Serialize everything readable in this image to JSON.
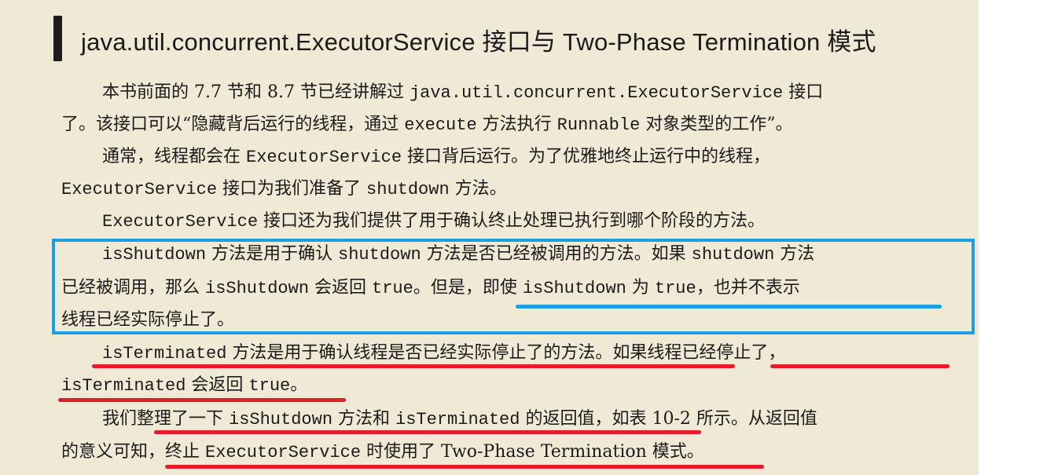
{
  "title": "java.util.concurrent.ExecutorService 接口与 Two-Phase Termination 模式",
  "paragraphs": {
    "p1": {
      "l1a": "本书前面的 7.7 节和 8.7 节已经讲解过 ",
      "l1b": "java.util.concurrent.ExecutorService",
      "l1c": " 接口",
      "l2a": "了。该接口可以“隐藏背后运行的线程，通过 ",
      "l2b": "execute",
      "l2c": " 方法执行 ",
      "l2d": "Runnable",
      "l2e": " 对象类型的工作”。"
    },
    "p2": {
      "l1a": "通常，线程都会在 ",
      "l1b": "ExecutorService",
      "l1c": " 接口背后运行。为了优雅地终止运行中的线程，",
      "l2a": "ExecutorService",
      "l2b": " 接口为我们准备了 ",
      "l2c": "shutdown",
      "l2d": " 方法。"
    },
    "p3": {
      "l1a": "ExecutorService",
      "l1b": " 接口还为我们提供了用于确认终止处理已执行到哪个阶段的方法。"
    },
    "p4": {
      "l1a": "isShutdown",
      "l1b": " 方法是用于确认 ",
      "l1c": "shutdown",
      "l1d": " 方法是否已经被调用的方法。如果 ",
      "l1e": "shutdown",
      "l1f": " 方法",
      "l2a": "已经被调用，那么 ",
      "l2b": "isShutdown",
      "l2c": " 会返回 ",
      "l2d": "true",
      "l2e": "。但是，即使 ",
      "l2f": "isShutdown",
      "l2g": " 为 ",
      "l2h": "true",
      "l2i": "，也并不表示",
      "l3a": "线程已经实际停止了。"
    },
    "p5": {
      "l1a": "isTerminated",
      "l1b": " 方法是用于确认线程是否已经实际停止了的方法。如果线程已经停止了，",
      "l2a": "isTerminated",
      "l2b": " 会返回 ",
      "l2c": "true",
      "l2d": "。"
    },
    "p6": {
      "l1a": "我们整理了一下 ",
      "l1b": "isShutdown",
      "l1c": " 方法和 ",
      "l1d": "isTerminated",
      "l1e": " 的返回值，如表 10-2 所示。从返回值",
      "l2a": "的意义可知，终止 ",
      "l2b": "ExecutorService",
      "l2c": " 时使用了 Two-Phase Termination 模式。"
    }
  },
  "annotation_colors": {
    "box": "#1b9ee3",
    "red_underline": "#e41c28",
    "blue_underline": "#1b9ee3"
  }
}
